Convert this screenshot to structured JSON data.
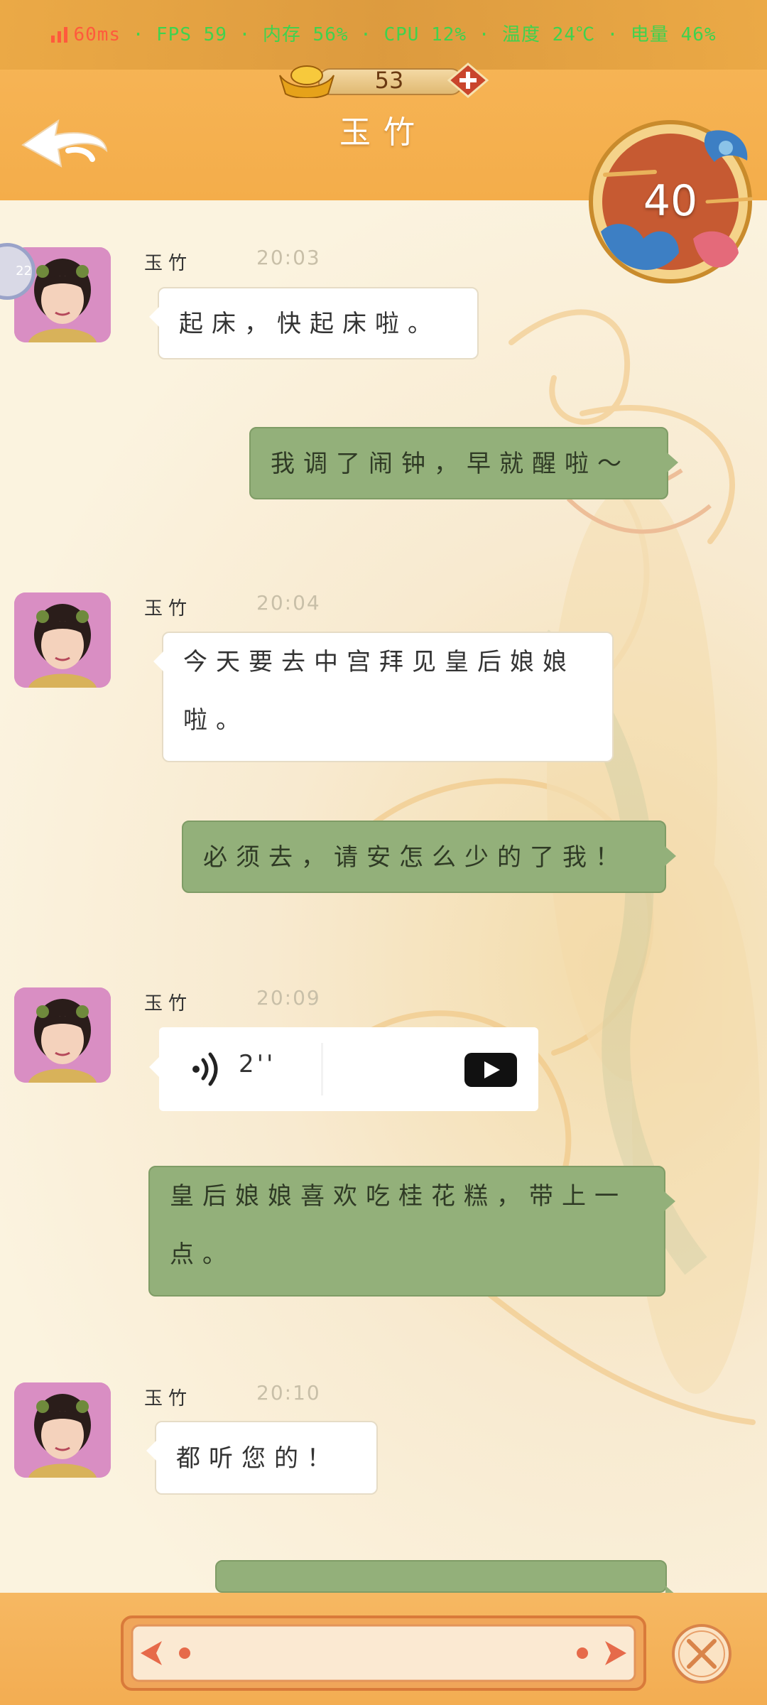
{
  "status_bar": {
    "ping": "60ms",
    "rest": " · FPS 59 · 内存 56% · CPU 12% · 温度 24℃ · 电量 46%"
  },
  "currency": {
    "amount": "53"
  },
  "header": {
    "title": "玉竹"
  },
  "badge": {
    "value": "40"
  },
  "side_tab": {
    "label": "22"
  },
  "messages": [
    {
      "sender": "玉竹",
      "time": "20:03",
      "text": "起床，快起床啦。"
    },
    {
      "text": "我调了闹钟，早就醒啦～"
    },
    {
      "sender": "玉竹",
      "time": "20:04",
      "line1": "今天要去中宫拜见皇后娘娘",
      "line2": "啦。"
    },
    {
      "text": "必须去，请安怎么少的了我！"
    },
    {
      "sender": "玉竹",
      "time": "20:09",
      "voice_duration": "2''"
    },
    {
      "line1": "皇后娘娘喜欢吃桂花糕，带上一",
      "line2": "点。"
    },
    {
      "sender": "玉竹",
      "time": "20:10",
      "text": "都听您的！"
    }
  ],
  "colors": {
    "header": "#f4ad4a",
    "incoming_bubble": "#ffffff",
    "outgoing_bubble": "#93b07a",
    "status_green": "#3fd24e",
    "status_red": "#ff5a3c"
  },
  "icons": [
    "signal-icon",
    "gold-ingot-icon",
    "plus-icon",
    "back-arrow-icon",
    "cloud-badge-icon",
    "voice-wave-icon",
    "video-camera-icon",
    "close-icon"
  ]
}
